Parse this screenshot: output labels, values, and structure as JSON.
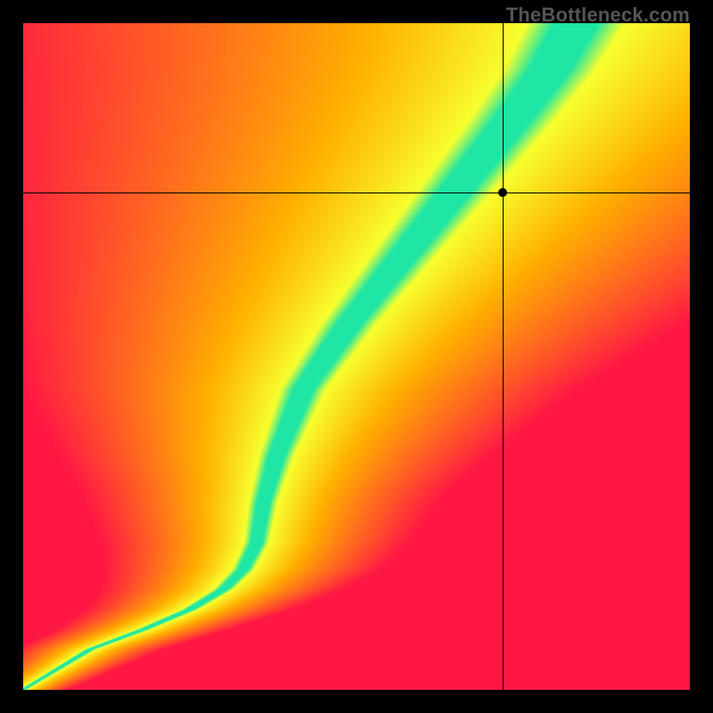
{
  "watermark": "TheBottleneck.com",
  "chart_data": {
    "type": "heatmap",
    "title": "",
    "xlabel": "",
    "ylabel": "",
    "xlim": [
      0,
      1
    ],
    "ylim": [
      0,
      1
    ],
    "grid": false,
    "legend": false,
    "annotations": [],
    "marker": {
      "x": 0.72,
      "y": 0.745,
      "label": ""
    },
    "crosshair": {
      "x": 0.72,
      "y": 0.745
    },
    "ridge": {
      "description": "x-position of minimal-bottleneck ridge as a function of y (normalized 0..1)",
      "y": [
        0.0,
        0.06,
        0.09,
        0.12,
        0.15,
        0.18,
        0.22,
        0.28,
        0.35,
        0.45,
        0.55,
        0.65,
        0.75,
        0.85,
        0.93,
        1.0
      ],
      "x": [
        0.0,
        0.1,
        0.18,
        0.25,
        0.3,
        0.33,
        0.35,
        0.36,
        0.38,
        0.42,
        0.49,
        0.57,
        0.65,
        0.73,
        0.79,
        0.83
      ]
    },
    "ridge_halfwidth": {
      "y": [
        0.0,
        0.1,
        0.18,
        0.3,
        0.45,
        0.6,
        0.75,
        0.88,
        1.0
      ],
      "w": [
        0.005,
        0.01,
        0.015,
        0.02,
        0.03,
        0.04,
        0.05,
        0.058,
        0.065
      ]
    },
    "colors": {
      "ridge": "#1fe6a4",
      "near": "#f7ff2e",
      "mid": "#ffb000",
      "far": "#ff1744"
    }
  }
}
